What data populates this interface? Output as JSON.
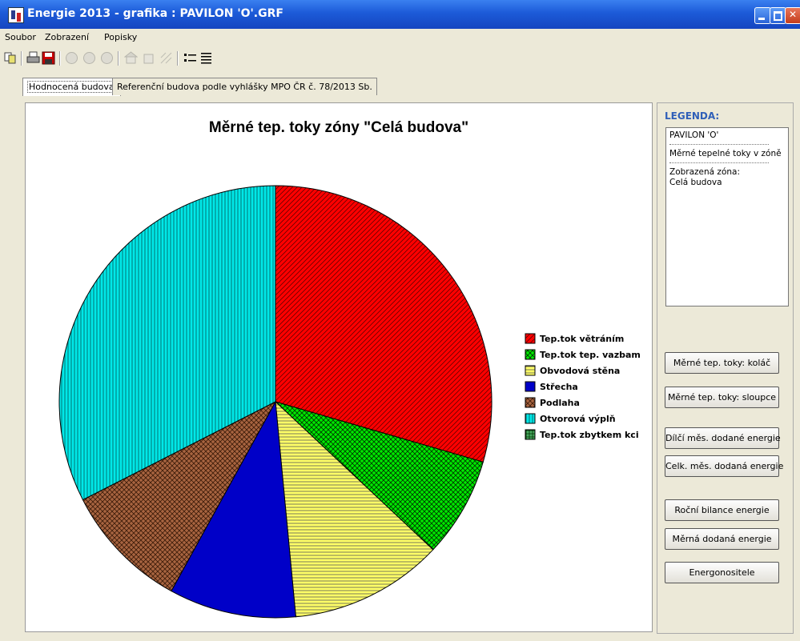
{
  "window": {
    "title": "Energie  2013 - grafika : PAVILON 'O'.GRF"
  },
  "menu": [
    "Soubor",
    "Zobrazení",
    "Popisky"
  ],
  "toolbar": [
    {
      "name": "copy-icon"
    },
    {
      "name": "print-icon"
    },
    {
      "name": "save-icon"
    },
    {
      "name": "zone-prev-icon"
    },
    {
      "name": "zone-icon"
    },
    {
      "name": "zone-next-icon"
    },
    {
      "name": "building-icon"
    },
    {
      "name": "reference-building-icon"
    },
    {
      "name": "grid-icon"
    },
    {
      "name": "legend-list-icon"
    },
    {
      "name": "align-icon"
    }
  ],
  "tabs": [
    {
      "label": "Hodnocená budova",
      "active": true
    },
    {
      "label": "Referenční budova podle vyhlášky MPO ČR č. 78/2013 Sb.",
      "active": false
    }
  ],
  "chart_data": {
    "type": "pie",
    "title": "Měrné tep. toky zóny \"Celá budova\"",
    "categories": [
      "Tep.tok větráním",
      "Tep.tok tep. vazbam",
      "Obvodová stěna",
      "Střecha",
      "Podlaha",
      "Otvorová výplň",
      "Tep.tok zbytkem kci"
    ],
    "values": [
      29.5,
      7.5,
      11.5,
      9.5,
      9.5,
      32.5,
      0
    ],
    "colors": [
      "#ff0000",
      "#00e800",
      "#ffff66",
      "#0000c8",
      "#a86440",
      "#00e8e8",
      "#48a860"
    ],
    "patterns": [
      "diag-right",
      "diag-cross",
      "horizontal",
      "solid",
      "diag-cross",
      "vertical",
      "grid"
    ],
    "legend_position": "right"
  },
  "legend_panel": {
    "heading": "LEGENDA:",
    "object_name": "PAVILON 'O'",
    "description": "Měrné tepelné toky v zóně",
    "zone_label": "Zobrazená zóna:",
    "zone_name": "Celá budova"
  },
  "buttons": [
    "Měrné tep. toky: koláč",
    "Měrné tep. toky: sloupce",
    "Dílčí měs. dodané energie",
    "Celk. měs. dodaná energie",
    "Roční bilance energie",
    "Měrná dodaná energie",
    "Energonositele"
  ]
}
